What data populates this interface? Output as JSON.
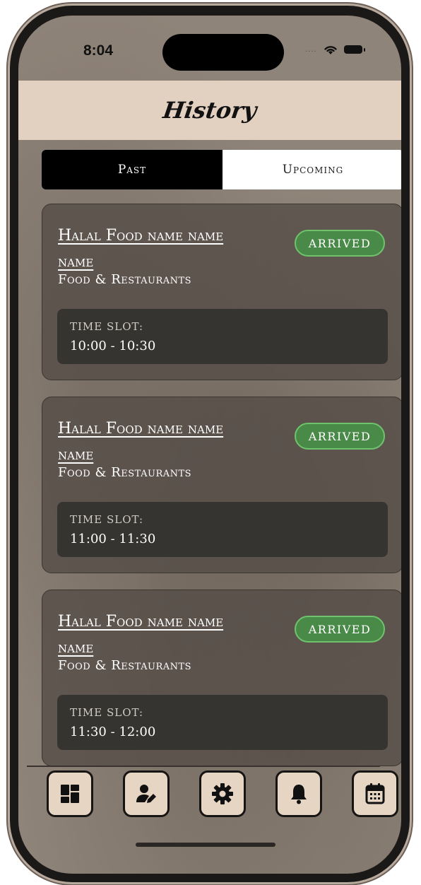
{
  "status_bar": {
    "time": "8:04",
    "signal": "....",
    "wifi_icon": "wifi-icon",
    "battery_icon": "battery-icon"
  },
  "header": {
    "title": "History"
  },
  "segments": [
    {
      "label": "Past",
      "active": true
    },
    {
      "label": "Upcoming",
      "active": false
    }
  ],
  "bookings": [
    {
      "title": "Halal Food name name name",
      "category": "Food & Restaurants",
      "status": "ARRIVED",
      "time_slot_label": "TIME SLOT:",
      "time_slot": "10:00 - 10:30"
    },
    {
      "title": "Halal Food name name name",
      "category": "Food & Restaurants",
      "status": "ARRIVED",
      "time_slot_label": "TIME SLOT:",
      "time_slot": "11:00 - 11:30"
    },
    {
      "title": "Halal Food name name name",
      "category": "Food & Restaurants",
      "status": "ARRIVED",
      "time_slot_label": "TIME SLOT:",
      "time_slot": "11:30 - 12:00"
    }
  ],
  "tab_bar": [
    {
      "icon": "dashboard-icon"
    },
    {
      "icon": "user-edit-icon"
    },
    {
      "icon": "settings-gear-icon"
    },
    {
      "icon": "bell-icon"
    },
    {
      "icon": "calendar-icon"
    }
  ],
  "colors": {
    "header_bg": "#e2d1c1",
    "screen_bg": "#8f8479",
    "card_bg": "#544c46",
    "badge_bg": "#4a8a48",
    "badge_border": "#6fc36c",
    "slot_bg": "#363431",
    "tab_button_bg": "#e7d5c3"
  }
}
